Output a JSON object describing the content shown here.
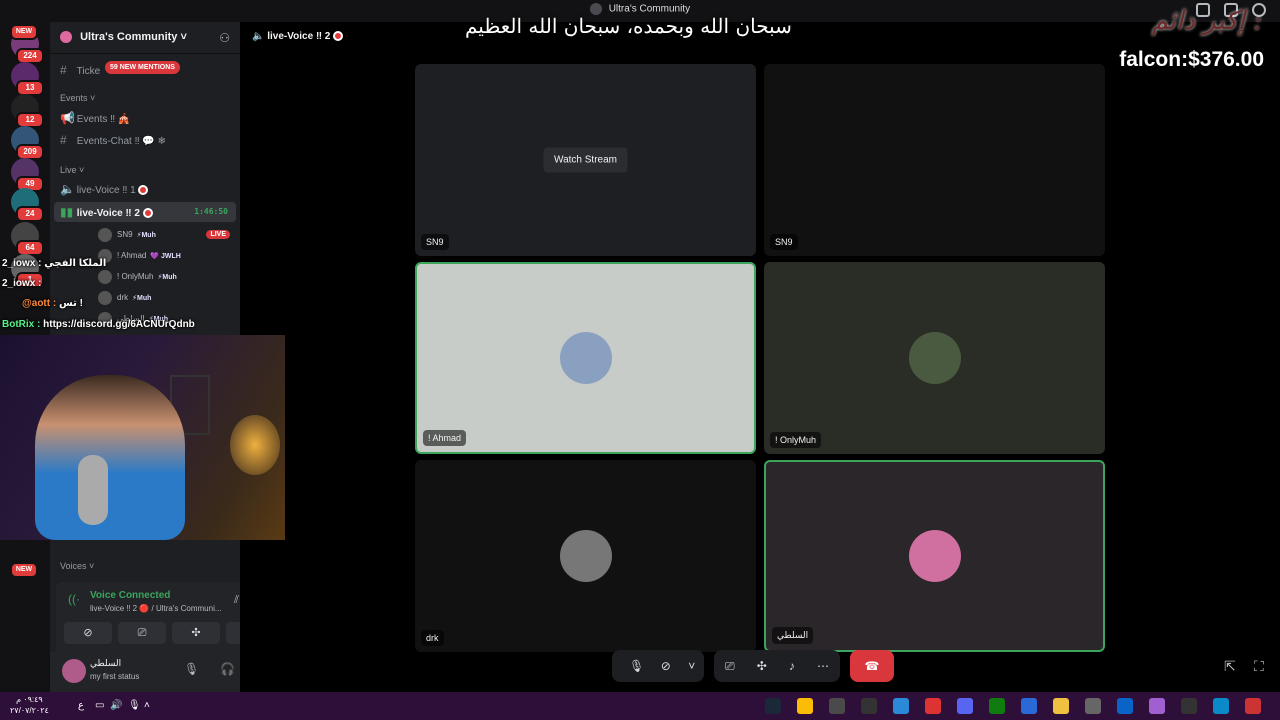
{
  "window": {
    "title": "Ultra's Community"
  },
  "overlay": {
    "arabic_dhikr": "سبحان الله وبحمده، سبحان الله العظيم",
    "akbar_text": "إكبر دائم :",
    "falcon_label": "falcon:$376.00",
    "chat": [
      {
        "user": "2_iowx :",
        "text": "الملكا الفجي"
      },
      {
        "user": "2_iowx :",
        "text": ""
      },
      {
        "user": "@aott :",
        "text": "تس !"
      },
      {
        "user": "BotRix :",
        "text": "https://discord.gg/6ACNUrQdnb"
      }
    ]
  },
  "servers": [
    {
      "badge": "224",
      "new": true,
      "color": "#7a3b7a"
    },
    {
      "badge": "13",
      "new": false,
      "color": "#5a2a6a"
    },
    {
      "badge": "12",
      "new": false,
      "color": "#222"
    },
    {
      "badge": "209",
      "new": false,
      "color": "#335577"
    },
    {
      "badge": "49",
      "new": false,
      "color": "#553366"
    },
    {
      "badge": "24",
      "new": false,
      "color": "#1e6e7a"
    },
    {
      "badge": "64",
      "new": false,
      "color": "#444"
    },
    {
      "badge": "1",
      "new": false,
      "color": "#666"
    }
  ],
  "sidebar": {
    "guild_name": "Ultra's Community",
    "guild_chevron": "˅",
    "mentions": "59 NEW MENTIONS",
    "ticket_prefix": "Ticke",
    "categories": {
      "events": "Events",
      "live": "Live",
      "voices": "Voices"
    },
    "channels": {
      "events": "Events ‼ 🎪",
      "events_chat": "Events-Chat ‼ 💬 ❄",
      "live_voice_1": "live-Voice ‼ 1",
      "live_voice_2": "live-Voice ‼ 2",
      "timer": "1:46:50"
    },
    "voice_users": [
      {
        "name": "SN9",
        "tag": "⚡Muh",
        "live": "LIVE"
      },
      {
        "name": "! Ahmad",
        "tag": "💜 JWLH"
      },
      {
        "name": "! OnlyMuh",
        "tag": "⚡Muh"
      },
      {
        "name": "drk",
        "tag": "⚡Muh"
      },
      {
        "name": "السلطي",
        "tag": "⚡Muh"
      }
    ],
    "voice_panel": {
      "status": "Voice Connected",
      "channel": "live-Voice ‼ 2 🔴 / Ultra's Communi..."
    },
    "user": {
      "name": "السلطي",
      "status": "my first status"
    }
  },
  "main": {
    "channel_title": "live-Voice ‼ 2",
    "watch_stream": "Watch Stream",
    "tiles": [
      {
        "name": "SN9",
        "stream": true
      },
      {
        "name": "SN9",
        "stream": false
      },
      {
        "name": "! Ahmad",
        "speaking": true
      },
      {
        "name": "! OnlyMuh"
      },
      {
        "name": "drk"
      },
      {
        "name": "السلطي",
        "speaking": true
      }
    ]
  },
  "taskbar": {
    "time": "٠٩:٤٩ م",
    "date": "٢٧/٠٧/٢٠٢٤",
    "lang": "ع"
  }
}
